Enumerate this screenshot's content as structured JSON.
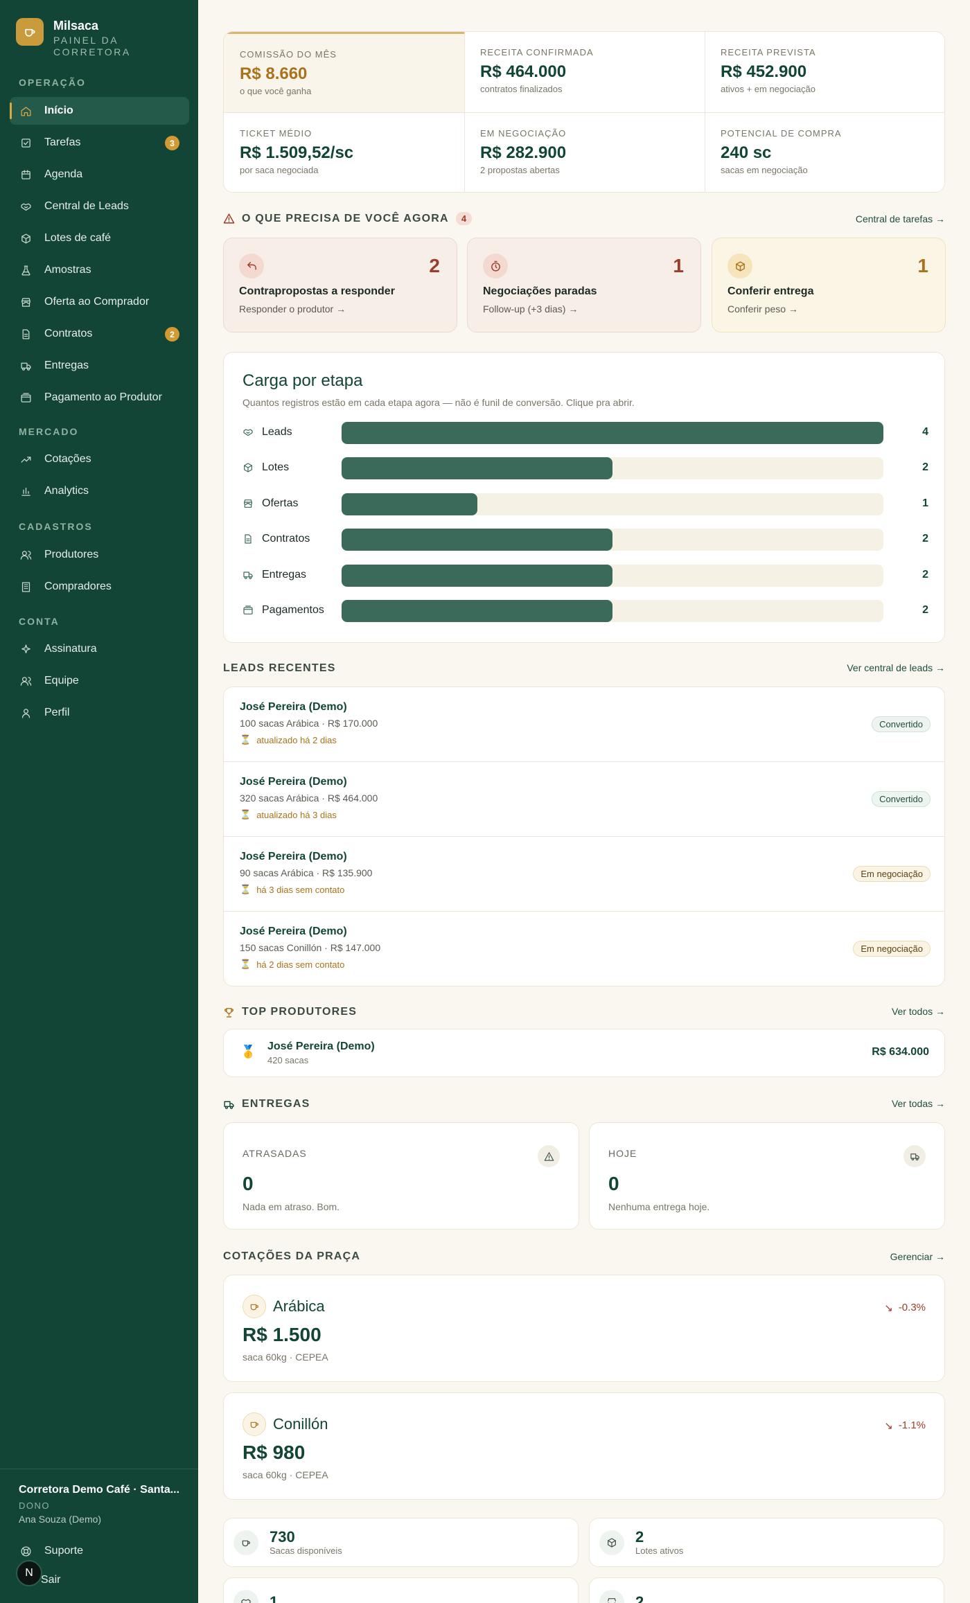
{
  "brand": {
    "name": "Milsaca",
    "subtitle_line1": "PAINEL DA",
    "subtitle_line2": "CORRETORA"
  },
  "sidebar": {
    "sections": {
      "operacao": "OPERAÇÃO",
      "mercado": "MERCADO",
      "cadastros": "CADASTROS",
      "conta": "CONTA"
    },
    "items": [
      {
        "label": "Início",
        "icon": "home-icon",
        "active": true
      },
      {
        "label": "Tarefas",
        "icon": "checklist-icon",
        "badge": "3"
      },
      {
        "label": "Agenda",
        "icon": "calendar-icon"
      },
      {
        "label": "Central de Leads",
        "icon": "handshake-icon"
      },
      {
        "label": "Lotes de café",
        "icon": "box-icon"
      },
      {
        "label": "Amostras",
        "icon": "flask-icon"
      },
      {
        "label": "Oferta ao Comprador",
        "icon": "store-icon"
      },
      {
        "label": "Contratos",
        "icon": "document-icon",
        "badge": "2"
      },
      {
        "label": "Entregas",
        "icon": "truck-icon"
      },
      {
        "label": "Pagamento ao Produtor",
        "icon": "wallet-icon"
      },
      {
        "label": "Cotações",
        "icon": "trend-icon"
      },
      {
        "label": "Analytics",
        "icon": "bar-chart-icon"
      },
      {
        "label": "Produtores",
        "icon": "users-icon"
      },
      {
        "label": "Compradores",
        "icon": "building-icon"
      },
      {
        "label": "Assinatura",
        "icon": "sparkle-icon"
      },
      {
        "label": "Equipe",
        "icon": "team-icon"
      },
      {
        "label": "Perfil",
        "icon": "user-icon"
      }
    ],
    "footer": {
      "org": "Corretora Demo Café · Santa...",
      "role": "DONO",
      "user": "Ana Souza (Demo)",
      "support": "Suporte",
      "logout": "Sair",
      "avatar_letter": "N"
    }
  },
  "kpis": [
    {
      "label": "COMISSÃO DO MÊS",
      "value": "R$ 8.660",
      "sub": "o que você ganha"
    },
    {
      "label": "RECEITA CONFIRMADA",
      "value": "R$ 464.000",
      "sub": "contratos finalizados"
    },
    {
      "label": "RECEITA PREVISTA",
      "value": "R$ 452.900",
      "sub": "ativos + em negociação"
    },
    {
      "label": "TICKET MÉDIO",
      "value": "R$ 1.509,52/sc",
      "sub": "por saca negociada"
    },
    {
      "label": "EM NEGOCIAÇÃO",
      "value": "R$ 282.900",
      "sub": "2 propostas abertas"
    },
    {
      "label": "POTENCIAL DE COMPRA",
      "value": "240 sc",
      "sub": "sacas em negociação"
    }
  ],
  "urgent": {
    "title": "O QUE PRECISA DE VOCÊ AGORA",
    "count": "4",
    "link": "Central de tarefas →",
    "cards": [
      {
        "title": "Contrapropostas a responder",
        "sub": "Responder o produtor →",
        "value": "2",
        "icon": "reply-icon"
      },
      {
        "title": "Negociações paradas",
        "sub": "Follow-up (+3 dias) →",
        "value": "1",
        "icon": "timer-icon"
      },
      {
        "title": "Conferir entrega",
        "sub": "Conferir peso →",
        "value": "1",
        "icon": "package-icon"
      }
    ]
  },
  "stages": {
    "title": "Carga por etapa",
    "subtitle": "Quantos registros estão em cada etapa agora — não é funil de conversão. Clique pra abrir.",
    "max": 4,
    "rows": [
      {
        "label": "Leads",
        "value": 4,
        "icon": "handshake-icon"
      },
      {
        "label": "Lotes",
        "value": 2,
        "icon": "box-icon"
      },
      {
        "label": "Ofertas",
        "value": 1,
        "icon": "store-icon"
      },
      {
        "label": "Contratos",
        "value": 2,
        "icon": "document-icon"
      },
      {
        "label": "Entregas",
        "value": 2,
        "icon": "truck-icon"
      },
      {
        "label": "Pagamentos",
        "value": 2,
        "icon": "wallet-icon"
      }
    ]
  },
  "leads": {
    "title": "LEADS RECENTES",
    "link": "Ver central de leads →",
    "rows": [
      {
        "name": "José Pereira (Demo)",
        "detail": "100 sacas Arábica · R$ 170.000",
        "meta": "atualizado há 2 dias",
        "status": "Convertido",
        "kind": "conv"
      },
      {
        "name": "José Pereira (Demo)",
        "detail": "320 sacas Arábica · R$ 464.000",
        "meta": "atualizado há 3 dias",
        "status": "Convertido",
        "kind": "conv"
      },
      {
        "name": "José Pereira (Demo)",
        "detail": "90 sacas Arábica · R$ 135.900",
        "meta": "há 3 dias sem contato",
        "status": "Em negociação",
        "kind": "neg"
      },
      {
        "name": "José Pereira (Demo)",
        "detail": "150 sacas Conillón · R$ 147.000",
        "meta": "há 2 dias sem contato",
        "status": "Em negociação",
        "kind": "neg"
      }
    ]
  },
  "top_producers": {
    "title": "TOP PRODUTORES",
    "link": "Ver todos →",
    "items": [
      {
        "name": "José Pereira (Demo)",
        "sub": "420 sacas",
        "value": "R$ 634.000"
      }
    ]
  },
  "deliveries": {
    "title": "ENTREGAS",
    "link": "Ver todas →",
    "late": {
      "label": "ATRASADAS",
      "value": "0",
      "sub": "Nada em atraso. Bom."
    },
    "today": {
      "label": "HOJE",
      "value": "0",
      "sub": "Nenhuma entrega hoje."
    }
  },
  "quotes": {
    "title": "COTAÇÕES DA PRAÇA",
    "link": "Gerenciar →",
    "items": [
      {
        "name": "Arábica",
        "price": "R$ 1.500",
        "sub": "saca 60kg · CEPEA",
        "change": "-0.3%"
      },
      {
        "name": "Conillón",
        "price": "R$ 980",
        "sub": "saca 60kg · CEPEA",
        "change": "-1.1%"
      }
    ]
  },
  "stats": [
    {
      "value": "730",
      "label": "Sacas disponíveis",
      "icon": "coffee-icon"
    },
    {
      "value": "2",
      "label": "Lotes ativos",
      "icon": "box-icon"
    },
    {
      "value": "1",
      "label": "",
      "icon": "handshake-icon"
    },
    {
      "value": "2",
      "label": "",
      "icon": "store-icon"
    }
  ],
  "colors": {
    "sidebar": "#134537",
    "accent": "#d8a746",
    "danger": "#9a3d2a",
    "background": "#faf7f0"
  }
}
